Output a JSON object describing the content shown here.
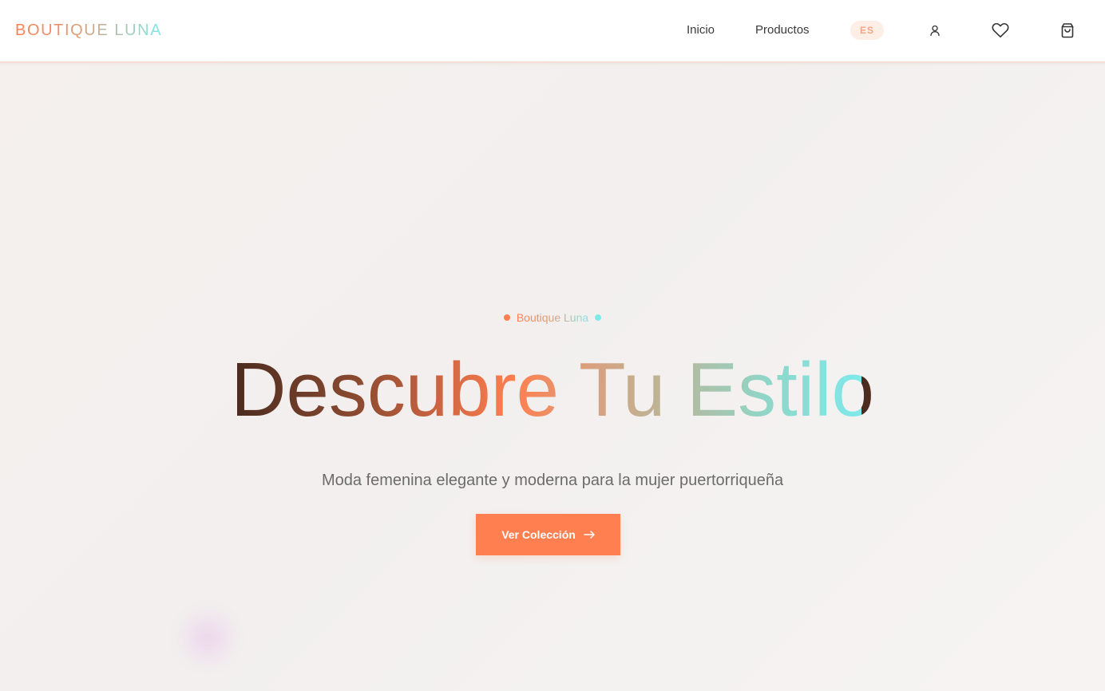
{
  "header": {
    "logo_text": "BOUTIQUE LUNA",
    "nav": [
      {
        "label": "Inicio"
      },
      {
        "label": "Productos"
      }
    ],
    "language": "ES",
    "icons": [
      "user-icon",
      "heart-icon",
      "shopping-bag-icon"
    ]
  },
  "hero": {
    "eyebrow": "Boutique Luna",
    "headline": "Descubre Tu Estilo",
    "subtitle": "Moda femenina elegante y moderna para la mujer puertorriqueña",
    "cta_label": "Ver Colección",
    "cta_icon": "arrow-right-icon"
  },
  "colors": {
    "accent": "#ff7f50",
    "teal": "#7fe9ea",
    "brown": "#4a2a1f",
    "text_muted": "#6b6b6b",
    "header_bg": "#ffffff",
    "hero_bg": "#f5f1ee",
    "lang_pill_bg": "#fdeee6"
  }
}
